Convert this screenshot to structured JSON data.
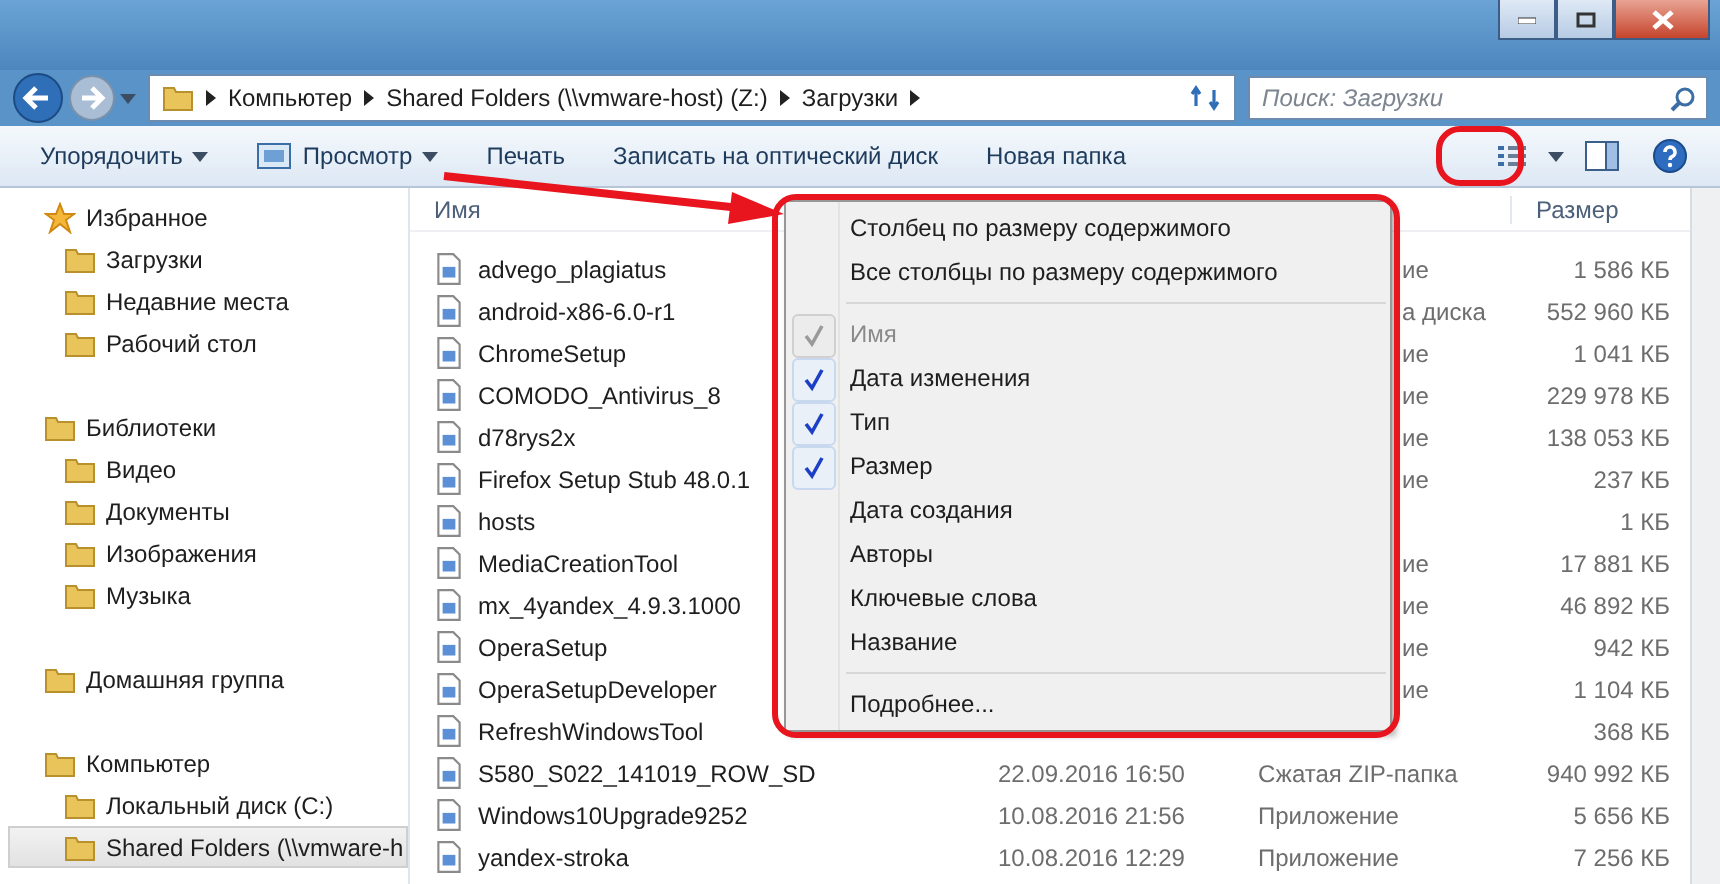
{
  "address_bar": {
    "path": [
      "Компьютер",
      "Shared Folders (\\\\vmware-host) (Z:)",
      "Загрузки"
    ]
  },
  "search": {
    "placeholder": "Поиск: Загрузки"
  },
  "toolbar": [
    {
      "label": "Упорядочить",
      "dropdown": true,
      "icon": false
    },
    {
      "label": "Просмотр",
      "dropdown": true,
      "icon": true
    },
    {
      "label": "Печать",
      "dropdown": false,
      "icon": false
    },
    {
      "label": "Записать на оптический диск",
      "dropdown": false,
      "icon": false
    },
    {
      "label": "Новая папка",
      "dropdown": false,
      "icon": false
    }
  ],
  "sidebar": {
    "items": [
      {
        "label": "Избранное",
        "children": [
          {
            "label": "Загрузки",
            "selected": false
          },
          {
            "label": "Недавние места",
            "selected": false
          },
          {
            "label": "Рабочий стол",
            "selected": false
          }
        ]
      },
      {
        "label": "Библиотеки",
        "children": [
          {
            "label": "Видео",
            "selected": false
          },
          {
            "label": "Документы",
            "selected": false
          },
          {
            "label": "Изображения",
            "selected": false
          },
          {
            "label": "Музыка",
            "selected": false
          }
        ]
      },
      {
        "label": "Домашняя группа"
      },
      {
        "label": "Компьютер",
        "children": [
          {
            "label": "Локальный диск (C:)",
            "selected": false
          },
          {
            "label": "Shared Folders (\\\\vmware-h",
            "selected": true
          }
        ]
      }
    ]
  },
  "table": {
    "columns": [
      "Имя",
      "Размер"
    ],
    "rows": [
      {
        "name": "advego_plagiatus",
        "type": "ие",
        "size": "1 586 КБ"
      },
      {
        "name": "android-x86-6.0-r1",
        "type": "а диска",
        "size": "552 960 КБ"
      },
      {
        "name": "ChromeSetup",
        "type": "ие",
        "size": "1 041 КБ"
      },
      {
        "name": "COMODO_Antivirus_8",
        "type": "ие",
        "size": "229 978 КБ"
      },
      {
        "name": "d78rys2x",
        "type": "ие",
        "size": "138 053 КБ"
      },
      {
        "name": "Firefox Setup Stub 48.0.1",
        "type": "ие",
        "size": "237 КБ"
      },
      {
        "name": "hosts",
        "size": "1 КБ"
      },
      {
        "name": "MediaCreationTool",
        "type": "ие",
        "size": "17 881 КБ"
      },
      {
        "name": "mx_4yandex_4.9.3.1000",
        "type": "ие",
        "size": "46 892 КБ"
      },
      {
        "name": "OperaSetup",
        "type": "ие",
        "size": "942 КБ"
      },
      {
        "name": "OperaSetupDeveloper",
        "type": "ие",
        "size": "1 104 КБ"
      },
      {
        "name": "RefreshWindowsTool",
        "size": "368 КБ"
      },
      {
        "name": "S580_S022_141019_ROW_SD",
        "date": "22.09.2016 16:50",
        "type": "Сжатая ZIP-папка",
        "size": "940 992 КБ"
      },
      {
        "name": "Windows10Upgrade9252",
        "date": "10.08.2016 21:56",
        "type": "Приложение",
        "size": "5 656 КБ"
      },
      {
        "name": "yandex-stroka",
        "date": "10.08.2016 12:29",
        "type": "Приложение",
        "size": "7 256 КБ"
      }
    ]
  },
  "context_menu": {
    "items": [
      {
        "kind": "command",
        "label": "Столбец по размеру содержимого"
      },
      {
        "kind": "command",
        "label": "Все столбцы по размеру содержимого"
      },
      {
        "kind": "separator"
      },
      {
        "kind": "column",
        "label": "Имя",
        "checked": true,
        "disabled": true
      },
      {
        "kind": "column",
        "label": "Дата изменения",
        "checked": true,
        "disabled": false
      },
      {
        "kind": "column",
        "label": "Тип",
        "checked": true,
        "disabled": false
      },
      {
        "kind": "column",
        "label": "Размер",
        "checked": true,
        "disabled": false
      },
      {
        "kind": "column",
        "label": "Дата создания",
        "checked": false,
        "disabled": false
      },
      {
        "kind": "column",
        "label": "Авторы",
        "checked": false,
        "disabled": false
      },
      {
        "kind": "column",
        "label": "Ключевые слова",
        "checked": false,
        "disabled": false
      },
      {
        "kind": "column",
        "label": "Название",
        "checked": false,
        "disabled": false
      },
      {
        "kind": "separator"
      },
      {
        "kind": "command",
        "label": "Подробнее..."
      }
    ]
  }
}
